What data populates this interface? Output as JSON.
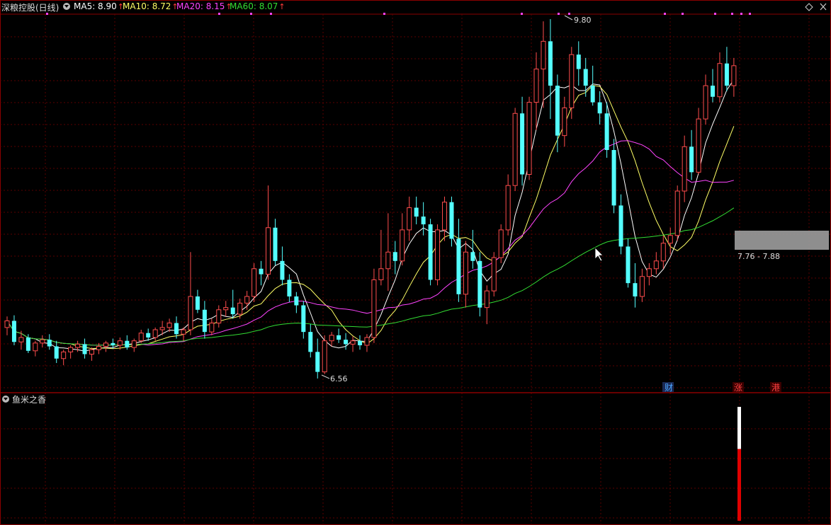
{
  "header": {
    "stock_title": "深粮控股(日线)",
    "ma5": {
      "label": "MA5: 8.90",
      "color": "#ffffff"
    },
    "ma10": {
      "label": "MA10: 8.72",
      "color": "#ffff66"
    },
    "ma20": {
      "label": "MA20: 8.15",
      "color": "#ff44ff"
    },
    "ma60": {
      "label": "MA60: 8.07",
      "color": "#33dd33"
    },
    "up_arrow": "↑"
  },
  "main_chart": {
    "high_label": "9.80",
    "low_label": "6.56",
    "range_label": "7.76 - 7.88",
    "event_markers": [
      {
        "text": "财",
        "color": "#4da6ff"
      },
      {
        "text": "涨",
        "color": "#ff4040"
      },
      {
        "text": "港",
        "color": "#ff4040"
      }
    ],
    "colors": {
      "up": "#ff4d4d",
      "down": "#54ffff",
      "grid": "#5a0000",
      "border": "#8b0000"
    }
  },
  "indicator_panel": {
    "title": "鱼米之香",
    "bar_colors": {
      "top": "#ffffff",
      "bottom": "#e00000"
    }
  },
  "chart_data": {
    "type": "candlestick",
    "price_labels": {
      "high": 9.8,
      "low": 6.56
    },
    "candles": [
      [
        7.02,
        7.12,
        6.95,
        7.08
      ],
      [
        7.08,
        7.13,
        6.86,
        6.89
      ],
      [
        6.89,
        6.99,
        6.82,
        6.93
      ],
      [
        6.93,
        6.96,
        6.79,
        6.81
      ],
      [
        6.81,
        6.9,
        6.76,
        6.88
      ],
      [
        6.88,
        6.95,
        6.84,
        6.91
      ],
      [
        6.91,
        6.96,
        6.82,
        6.85
      ],
      [
        6.85,
        6.9,
        6.7,
        6.74
      ],
      [
        6.74,
        6.82,
        6.68,
        6.8
      ],
      [
        6.8,
        6.86,
        6.74,
        6.84
      ],
      [
        6.84,
        6.9,
        6.8,
        6.87
      ],
      [
        6.87,
        6.92,
        6.74,
        6.78
      ],
      [
        6.78,
        6.84,
        6.72,
        6.82
      ],
      [
        6.82,
        6.88,
        6.78,
        6.85
      ],
      [
        6.85,
        6.9,
        6.8,
        6.88
      ],
      [
        6.88,
        6.92,
        6.83,
        6.86
      ],
      [
        6.86,
        6.93,
        6.82,
        6.9
      ],
      [
        6.9,
        6.95,
        6.82,
        6.84
      ],
      [
        6.84,
        6.92,
        6.8,
        6.9
      ],
      [
        6.9,
        7.0,
        6.88,
        6.97
      ],
      [
        6.97,
        7.01,
        6.9,
        6.93
      ],
      [
        6.93,
        7.02,
        6.9,
        7.0
      ],
      [
        7.0,
        7.08,
        6.95,
        7.02
      ],
      [
        7.02,
        7.1,
        6.98,
        7.06
      ],
      [
        7.06,
        7.12,
        6.92,
        6.96
      ],
      [
        6.96,
        7.02,
        6.9,
        7.0
      ],
      [
        7.0,
        7.7,
        6.95,
        7.3
      ],
      [
        7.3,
        7.36,
        7.15,
        7.18
      ],
      [
        7.18,
        7.26,
        6.92,
        6.98
      ],
      [
        6.98,
        7.1,
        6.95,
        7.06
      ],
      [
        7.06,
        7.22,
        7.02,
        7.18
      ],
      [
        7.18,
        7.26,
        7.12,
        7.2
      ],
      [
        7.2,
        7.36,
        7.1,
        7.14
      ],
      [
        7.14,
        7.28,
        7.1,
        7.24
      ],
      [
        7.24,
        7.35,
        7.18,
        7.3
      ],
      [
        7.3,
        7.6,
        7.25,
        7.55
      ],
      [
        7.55,
        7.62,
        7.4,
        7.5
      ],
      [
        7.5,
        8.3,
        7.45,
        7.92
      ],
      [
        7.92,
        8.0,
        7.58,
        7.62
      ],
      [
        7.62,
        7.75,
        7.4,
        7.45
      ],
      [
        7.45,
        7.5,
        7.25,
        7.3
      ],
      [
        7.3,
        7.34,
        7.15,
        7.22
      ],
      [
        7.22,
        7.26,
        6.92,
        6.98
      ],
      [
        6.98,
        7.05,
        6.75,
        6.8
      ],
      [
        6.8,
        6.92,
        6.56,
        6.62
      ],
      [
        6.62,
        6.95,
        6.6,
        6.9
      ],
      [
        6.9,
        6.98,
        6.85,
        6.95
      ],
      [
        6.95,
        7.01,
        6.88,
        6.91
      ],
      [
        6.91,
        6.97,
        6.82,
        6.87
      ],
      [
        6.87,
        6.94,
        6.8,
        6.9
      ],
      [
        6.9,
        6.95,
        6.82,
        6.86
      ],
      [
        6.86,
        6.96,
        6.8,
        6.93
      ],
      [
        6.93,
        7.55,
        6.88,
        7.45
      ],
      [
        7.45,
        7.9,
        7.4,
        7.55
      ],
      [
        7.55,
        8.05,
        7.35,
        7.7
      ],
      [
        7.7,
        7.8,
        7.5,
        7.62
      ],
      [
        7.62,
        8.05,
        7.58,
        7.9
      ],
      [
        7.9,
        8.2,
        7.8,
        8.1
      ],
      [
        8.1,
        8.2,
        7.95,
        8.02
      ],
      [
        8.02,
        8.15,
        7.85,
        7.95
      ],
      [
        7.95,
        8.0,
        7.4,
        7.45
      ],
      [
        7.45,
        7.95,
        7.4,
        7.9
      ],
      [
        7.9,
        8.2,
        7.8,
        8.15
      ],
      [
        8.15,
        8.2,
        7.75,
        7.82
      ],
      [
        7.82,
        8.0,
        7.25,
        7.32
      ],
      [
        7.32,
        7.8,
        7.2,
        7.7
      ],
      [
        7.7,
        7.9,
        7.55,
        7.62
      ],
      [
        7.62,
        7.7,
        7.12,
        7.2
      ],
      [
        7.2,
        7.4,
        7.05,
        7.35
      ],
      [
        7.35,
        7.7,
        7.3,
        7.65
      ],
      [
        7.65,
        7.95,
        7.6,
        7.9
      ],
      [
        7.9,
        8.4,
        7.85,
        8.3
      ],
      [
        8.3,
        9.0,
        8.25,
        8.95
      ],
      [
        8.95,
        9.1,
        8.3,
        8.4
      ],
      [
        8.4,
        9.1,
        8.35,
        9.05
      ],
      [
        9.05,
        9.5,
        8.8,
        9.35
      ],
      [
        9.35,
        9.78,
        9.0,
        9.6
      ],
      [
        9.6,
        9.8,
        8.9,
        9.2
      ],
      [
        9.2,
        9.3,
        8.6,
        8.75
      ],
      [
        8.75,
        9.1,
        8.65,
        9.0
      ],
      [
        9.0,
        9.55,
        8.9,
        9.48
      ],
      [
        9.48,
        9.6,
        9.2,
        9.35
      ],
      [
        9.35,
        9.45,
        9.1,
        9.2
      ],
      [
        9.2,
        9.38,
        9.02,
        9.05
      ],
      [
        9.05,
        9.15,
        8.85,
        8.95
      ],
      [
        8.95,
        9.05,
        8.55,
        8.62
      ],
      [
        8.62,
        8.72,
        8.05,
        8.12
      ],
      [
        8.12,
        8.22,
        7.68,
        7.75
      ],
      [
        7.75,
        7.82,
        7.38,
        7.42
      ],
      [
        7.42,
        7.6,
        7.2,
        7.3
      ],
      [
        7.3,
        7.55,
        7.25,
        7.48
      ],
      [
        7.48,
        7.6,
        7.4,
        7.55
      ],
      [
        7.55,
        7.7,
        7.5,
        7.62
      ],
      [
        7.62,
        7.85,
        7.55,
        7.78
      ],
      [
        7.78,
        7.92,
        7.68,
        7.85
      ],
      [
        7.85,
        8.3,
        7.8,
        8.25
      ],
      [
        8.25,
        8.75,
        8.15,
        8.65
      ],
      [
        8.65,
        8.8,
        8.35,
        8.42
      ],
      [
        8.42,
        9.0,
        8.4,
        8.9
      ],
      [
        8.9,
        9.3,
        8.85,
        9.2
      ],
      [
        9.2,
        9.35,
        9.05,
        9.1
      ],
      [
        9.1,
        9.5,
        9.05,
        9.4
      ],
      [
        9.4,
        9.55,
        9.15,
        9.2
      ],
      [
        9.2,
        9.45,
        9.1,
        9.38
      ]
    ],
    "ma_lines_latest": {
      "MA5": 8.9,
      "MA10": 8.72,
      "MA20": 8.15,
      "MA60": 8.07
    },
    "highlight_band": [
      7.76,
      7.88
    ],
    "indicator_bar": {
      "white_fraction": 0.37,
      "red_fraction": 0.63
    }
  }
}
